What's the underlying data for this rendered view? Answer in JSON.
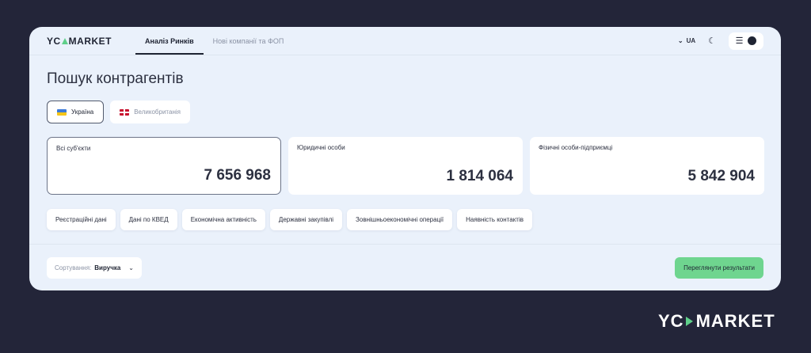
{
  "app": {
    "logo_left": "YC",
    "logo_right": "ARKET",
    "logo_m": "M"
  },
  "nav": {
    "tabs": [
      {
        "label": "Аналіз Ринків",
        "active": true
      },
      {
        "label": "Нові компанії та ФОП",
        "active": false
      }
    ]
  },
  "topbar": {
    "lang": "UA",
    "lang_icon": "chevron-down-icon",
    "theme_icon": "moon-icon",
    "menu_icon": "hamburger-icon",
    "user_icon": "user-icon"
  },
  "page": {
    "title": "Пошук контрагентів"
  },
  "countries": [
    {
      "label": "Україна",
      "active": true
    },
    {
      "label": "Великобританія",
      "active": false
    }
  ],
  "stats": [
    {
      "label": "Всі суб'єкти",
      "value": "7 656 968",
      "active": true
    },
    {
      "label": "Юридичні особи",
      "value": "1 814 064",
      "active": false
    },
    {
      "label": "Фізичні особи-підприємці",
      "value": "5 842 904",
      "active": false
    }
  ],
  "filters": [
    "Реєстраційні дані",
    "Дані по КВЕД",
    "Економічна активність",
    "Державні закупівлі",
    "Зовнішньоекономічні операції",
    "Наявність контактів"
  ],
  "sort": {
    "label": "Сортування:",
    "value": "Виручка"
  },
  "actions": {
    "results_label": "Переглянути результати"
  },
  "brand": {
    "left": "YC",
    "right": "MARKET"
  },
  "colors": {
    "background": "#232539",
    "panel": "#eaf1fb",
    "accent": "#6fd58f"
  }
}
